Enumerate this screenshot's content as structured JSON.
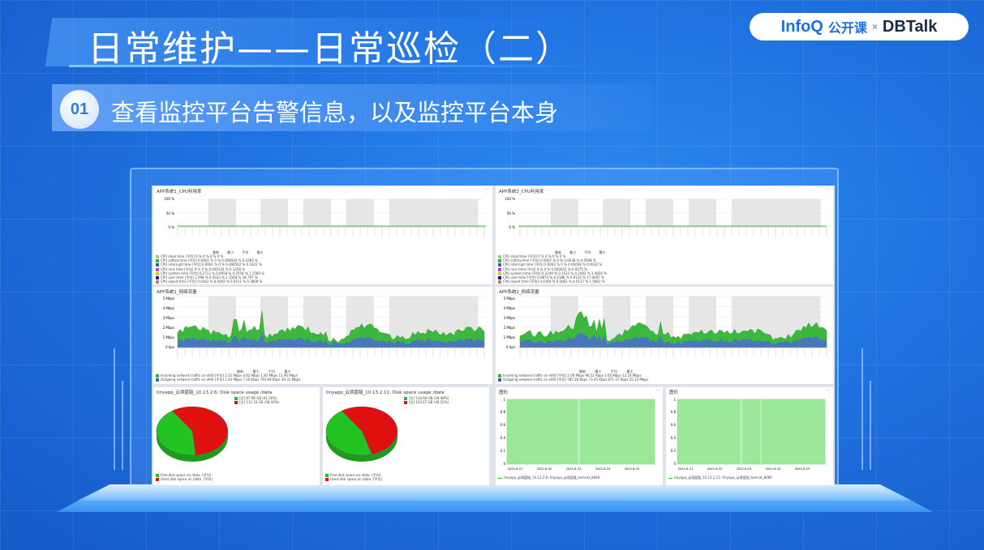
{
  "slide": {
    "title": "日常维护——日常巡检（二）",
    "subtitle_number": "01",
    "subtitle": "查看监控平台告警信息，以及监控平台本身",
    "logo": {
      "infoq": "InfoQ",
      "gkk": "公开课",
      "x": "×",
      "dbtalk": "DBTalk"
    }
  },
  "colors": {
    "accent": "#1f72e0",
    "green": "#2eb82e",
    "red": "#e01010",
    "blue": "#3060c0"
  },
  "dashboard": {
    "cpu1": {
      "title": "APP系统1_CPU利用率",
      "yticks": [
        "100 %",
        "50 %",
        "0 %"
      ],
      "legend_header": [
        "最新",
        "最小",
        "平均",
        "最大"
      ],
      "rows": [
        {
          "name": "CPU steal time",
          "agg": "[平均]",
          "v": [
            "0 %",
            "0 %",
            "0 %",
            "0 %"
          ]
        },
        {
          "name": "CPU softirq time",
          "agg": "[平均]",
          "v": [
            "0.0061 %",
            "0 %",
            "0.008584 %",
            "0.1683 %"
          ]
        },
        {
          "name": "CPU interrupt time",
          "agg": "[平均]",
          "v": [
            "0.0061 %",
            "0 %",
            "0.008562 %",
            "0.1622 %"
          ]
        },
        {
          "name": "CPU nice time",
          "agg": "[平均]",
          "v": [
            "0 %",
            "0 %",
            "0.000124 %",
            "0.1258 %"
          ]
        },
        {
          "name": "CPU system time",
          "agg": "[平均]",
          "v": [
            "0.2713 %",
            "0.0658 %",
            "0.2554 %",
            "1.1569 %"
          ]
        },
        {
          "name": "CPU user time",
          "agg": "[平均]",
          "v": [
            "1.098 %",
            "0.0333 %",
            "1.1568 %",
            "18.797 %"
          ]
        },
        {
          "name": "CPU iowait time",
          "agg": "[平均]",
          "v": [
            "0.0163 %",
            "0.0002 %",
            "0.0511 %",
            "0.3608 %"
          ]
        }
      ]
    },
    "cpu2": {
      "title": "APP系统2_CPU利用率",
      "yticks": [
        "100 %",
        "50 %",
        "0 %"
      ],
      "legend_header": [
        "最新",
        "最小",
        "平均",
        "最大"
      ],
      "rows": [
        {
          "name": "CPU steal time",
          "agg": "[平均]",
          "v": [
            "0 %",
            "0 %",
            "0 %",
            "0 %"
          ]
        },
        {
          "name": "CPU softirq time",
          "agg": "[平均]",
          "v": [
            "0.0067 %",
            "0 %",
            "0.0038 %",
            "0.0598 %"
          ]
        },
        {
          "name": "CPU interrupt time",
          "agg": "[平均]",
          "v": [
            "0.0003 %",
            "0 %",
            "0.00059 %",
            "0.0032 %"
          ]
        },
        {
          "name": "CPU nice time",
          "agg": "[平均]",
          "v": [
            "0 %",
            "0 %",
            "0.000032 %",
            "0.0275 %"
          ]
        },
        {
          "name": "CPU system time",
          "agg": "[平均]",
          "v": [
            "0.2249 %",
            "0.1522 %",
            "0.2492 %",
            "1.4856 %"
          ]
        },
        {
          "name": "CPU user time",
          "agg": "[平均]",
          "v": [
            "0.9874 %",
            "0.2188 %",
            "0.9122 %",
            "17.0697 %"
          ]
        },
        {
          "name": "CPU iowait time",
          "agg": "[平均]",
          "v": [
            "0.0169 %",
            "0.0062 %",
            "0.0137 %",
            "1.5681 %"
          ]
        }
      ]
    },
    "net1": {
      "title": "APP系统1_网络流量",
      "yticks": [
        "5 Mbps",
        "4 Mbps",
        "3 Mbps",
        "2 Mbps",
        "1 Mbps",
        "0 bps"
      ],
      "legend_header": [
        "最新",
        "最小",
        "平均",
        "最大"
      ],
      "rows": [
        {
          "name": "Incoming network traffic on eth0",
          "agg": "[平均]",
          "v": [
            "2.22 Mbps",
            "0.82 Mbps",
            "1.83 Mbps",
            "11.94 Mbps"
          ]
        },
        {
          "name": "Outgoing network traffic on eth0",
          "agg": "[平均]",
          "v": [
            "1.44 Mbps",
            "7.16 Kbps",
            "793.09 Kbps",
            "39.31 Mbps"
          ]
        }
      ]
    },
    "net2": {
      "title": "APP系统2_网络流量",
      "yticks": [
        "5 Mbps",
        "4 Mbps",
        "3 Mbps",
        "2 Mbps",
        "1 Mbps",
        "0 bps"
      ],
      "legend_header": [
        "最新",
        "最小",
        "平均",
        "最大"
      ],
      "rows": [
        {
          "name": "Incoming network traffic on eth0",
          "agg": "[平均]",
          "v": [
            "2.04 Mbps",
            "96.52 Kbps",
            "1.65 Mbps",
            "12.24 Mbps"
          ]
        },
        {
          "name": "Outgoing network traffic on eth0",
          "agg": "[平均]",
          "v": [
            "785.26 Kbps",
            "73.45 Kbps",
            "871.37 Kbps",
            "55.13 Mbps"
          ]
        }
      ]
    },
    "disk1": {
      "title": "tinyapp_云境盘链_10.13.2.6: Disk space usage /data",
      "free_fraction": 0.42,
      "legend_top": [
        "[文] 87.98 GB (41.50%)",
        "[文] 111.16 GB (58.50%)"
      ],
      "legend_bottom": [
        "Free disk space on /data",
        "Used disk space on /data"
      ],
      "agg": "[平均]"
    },
    "disk2": {
      "title": "tinyapp_云境盘链_10.13.2.11: Disk space usage /data",
      "free_fraction": 0.45,
      "legend_top": [
        "[文] 116.68 GB (58.48%)",
        "[文] 102.67 GB (46.52%)"
      ],
      "legend_bottom": [
        "Free disk space on /data",
        "Used disk space on /data"
      ],
      "agg": "[平均]"
    },
    "hb1": {
      "title": "图形",
      "yticks": [
        "1",
        "0.8",
        "0.6",
        "0.4",
        "0.2",
        "0"
      ],
      "xticks": [
        "2022-6-21",
        "2022-6-22",
        "2022-6-23",
        "2022-6-24",
        "2022-6-25"
      ],
      "legend": "tinyapp_云境盘链_10.13.2.6: tinyapp_云境盘链_tomcat_8080"
    },
    "hb2": {
      "title": "图形",
      "yticks": [
        "1",
        "0.8",
        "0.6",
        "0.4",
        "0.2",
        "0"
      ],
      "xticks": [
        "2022-6-21",
        "2022-6-22",
        "2022-6-23",
        "2022-6-24",
        "2022-6-25"
      ],
      "legend": "tinyapp_云境盘链_10.13.2.11: tinyapp_云境盘链_tomcat_8080"
    }
  }
}
